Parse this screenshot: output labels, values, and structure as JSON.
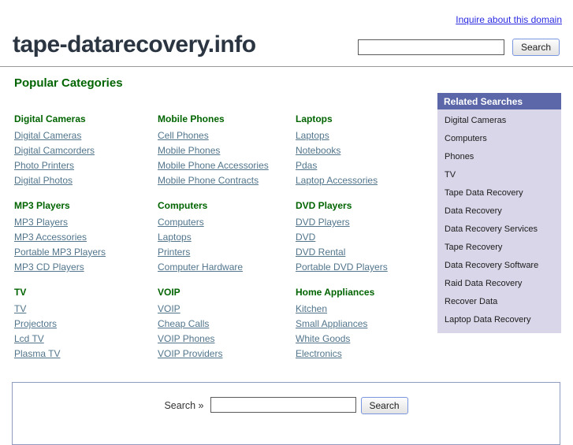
{
  "header": {
    "inquire_link": "Inquire about this domain",
    "domain": "tape-datarecovery.info",
    "search_value": "",
    "search_button": "Search"
  },
  "popular": {
    "title": "Popular Categories",
    "groups": [
      {
        "title": "Digital Cameras",
        "links": [
          "Digital Cameras",
          "Digital Camcorders",
          "Photo Printers",
          "Digital Photos"
        ]
      },
      {
        "title": "Mobile Phones",
        "links": [
          "Cell Phones",
          "Mobile Phones",
          "Mobile Phone Accessories",
          "Mobile Phone Contracts"
        ]
      },
      {
        "title": "Laptops",
        "links": [
          "Laptops",
          "Notebooks",
          "Pdas",
          "Laptop Accessories"
        ]
      },
      {
        "title": "MP3 Players",
        "links": [
          "MP3 Players",
          "MP3 Accessories",
          "Portable MP3 Players",
          "MP3 CD Players"
        ]
      },
      {
        "title": "Computers",
        "links": [
          "Computers",
          "Laptops",
          "Printers",
          "Computer Hardware"
        ]
      },
      {
        "title": "DVD Players",
        "links": [
          "DVD Players",
          "DVD",
          "DVD Rental",
          "Portable DVD Players"
        ]
      },
      {
        "title": "TV",
        "links": [
          "TV",
          "Projectors",
          "Lcd TV",
          "Plasma TV"
        ]
      },
      {
        "title": "VOIP",
        "links": [
          "VOIP",
          "Cheap Calls",
          "VOIP Phones",
          "VOIP Providers"
        ]
      },
      {
        "title": "Home Appliances",
        "links": [
          "Kitchen",
          "Small Appliances",
          "White Goods",
          "Electronics"
        ]
      }
    ]
  },
  "related": {
    "title": "Related Searches",
    "items": [
      "Digital Cameras",
      "Computers",
      "Phones",
      "TV",
      "Tape Data Recovery",
      "Data Recovery",
      "Data Recovery Services",
      "Tape Recovery",
      "Data Recovery Software",
      "Raid Data Recovery",
      "Recover Data",
      "Laptop Data Recovery"
    ]
  },
  "footer": {
    "label": "Search »",
    "search_value": "",
    "button": "Search"
  },
  "colors": {
    "inquire_link": "#2b2be2",
    "title_text": "#2b3542",
    "heading_green": "#006400",
    "category_link": "#52758c",
    "sidebar_header_bg": "#5b67a8",
    "sidebar_body_bg": "#d8d6e8",
    "footer_border": "#8f9cc0"
  }
}
